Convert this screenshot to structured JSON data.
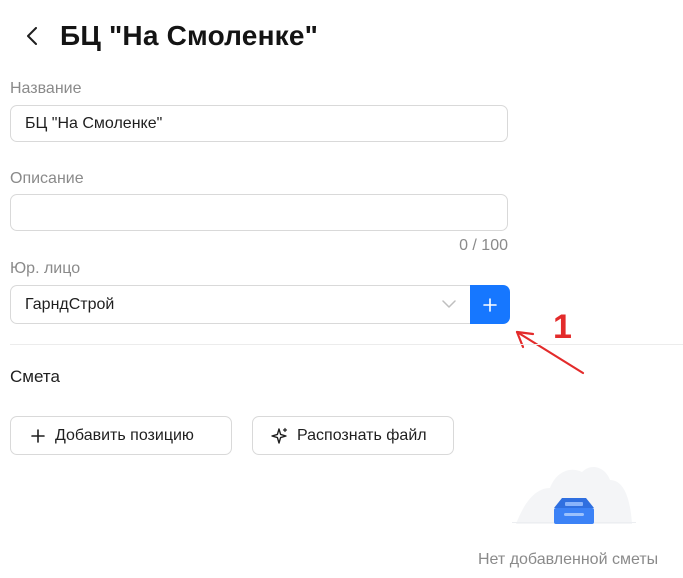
{
  "header": {
    "back_icon": "chevron-left-icon",
    "title": "БЦ \"На Смоленке\""
  },
  "form": {
    "name": {
      "label": "Название",
      "value": "БЦ \"На Смоленке\""
    },
    "description": {
      "label": "Описание",
      "value": "",
      "counter": "0 / 100"
    },
    "legal_entity": {
      "label": "Юр. лицо",
      "value": "ГарндСтрой",
      "dropdown_icon": "chevron-down-icon",
      "add_icon": "plus-icon"
    }
  },
  "estimate": {
    "title": "Смета",
    "add_position_label": "Добавить позицию",
    "add_position_icon": "plus-icon",
    "recognize_file_label": "Распознать файл",
    "recognize_file_icon": "sparkle-icon",
    "empty_text": "Нет добавленной сметы"
  },
  "annotation": {
    "number": "1",
    "color": "#e32b2b"
  },
  "colors": {
    "accent": "#1677ff",
    "muted_text": "#8a8a8a",
    "border": "#d9d9d9"
  }
}
